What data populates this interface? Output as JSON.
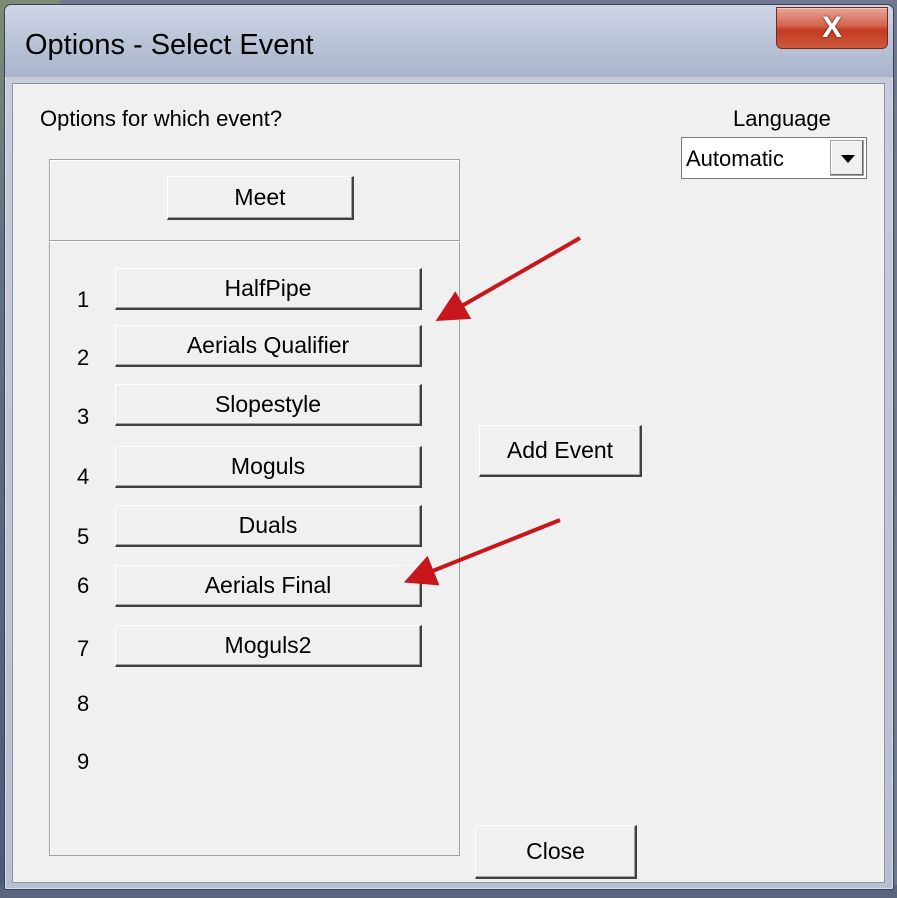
{
  "window": {
    "title": "Options - Select Event",
    "close_glyph": "X"
  },
  "prompt": "Options for which event?",
  "language": {
    "label": "Language",
    "value": "Automatic"
  },
  "meet_button": "Meet",
  "events": [
    {
      "num": "1",
      "label": "HalfPipe"
    },
    {
      "num": "2",
      "label": "Aerials Qualifier"
    },
    {
      "num": "3",
      "label": "Slopestyle"
    },
    {
      "num": "4",
      "label": "Moguls"
    },
    {
      "num": "5",
      "label": "Duals"
    },
    {
      "num": "6",
      "label": "Aerials Final"
    },
    {
      "num": "7",
      "label": "Moguls2"
    },
    {
      "num": "8",
      "label": ""
    },
    {
      "num": "9",
      "label": ""
    }
  ],
  "add_event_button": "Add Event",
  "close_button": "Close",
  "colors": {
    "arrow": "#c8161d",
    "close_red": "#c23a22"
  }
}
